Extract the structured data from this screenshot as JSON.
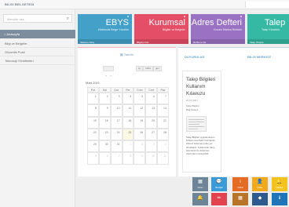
{
  "topbar": {
    "title": "BILGI BELGETESI"
  },
  "sidebar": {
    "search_placeholder": "Menüde ara...",
    "items": [
      {
        "label": "Anasayfa",
        "active": true
      },
      {
        "label": "Bilgi ve Belgeler"
      },
      {
        "label": "Güvenlik Posti"
      },
      {
        "label": "Teknoloji Yönetimleri"
      }
    ]
  },
  "tiles": [
    {
      "name": "EBYS",
      "sub": "Elektronik Belge Yönetim",
      "foot": "Sisteme Giriş",
      "color": "#43a0c8"
    },
    {
      "name": "Kurumsal",
      "sub": "Bilgiler ve Belgeler",
      "foot": "Bilgileri Gör",
      "color": "#e54e67"
    },
    {
      "name": "Adres Defteri",
      "sub": "Kurum Telefon Rehberi",
      "foot": "Rehbere Git",
      "color": "#9a72c4"
    },
    {
      "name": "Talep",
      "sub": "Talep Yönetimi",
      "foot": "Talep Oluştur",
      "color": "#35b8a4"
    }
  ],
  "calendar": {
    "title": "Takvim",
    "nav_prev": "‹",
    "nav_next": "›",
    "views": [
      "ay",
      "hafta",
      "gün"
    ],
    "month_label": "Mart 2021",
    "weekdays": [
      "Pzt",
      "Sal",
      "Çar",
      "Per",
      "Cum",
      "Cmt",
      "Paz"
    ],
    "weeks": [
      [
        "1",
        "2",
        "3",
        "4",
        "5",
        "6",
        "7"
      ],
      [
        "8",
        "9",
        "10",
        "11",
        "12",
        "13",
        "14"
      ],
      [
        "15",
        "16",
        "17",
        "18",
        "19",
        "20",
        "21"
      ],
      [
        "22",
        "23",
        "24",
        "25",
        "26",
        "27",
        "28"
      ],
      [
        "29",
        "30",
        "31",
        "1",
        "2",
        "3",
        "4"
      ],
      [
        "5",
        "6",
        "7",
        "8",
        "9",
        "10",
        "11"
      ]
    ],
    "today": "25"
  },
  "news": {
    "heading_left": "DUYURULAR",
    "heading_right": "BİLGİ MERKEZİ",
    "card_title": "Talep Bilgileri Kullanım Kılavuzu",
    "card_date": "26.03.2021",
    "card_lines": [
      "Talep Bilgileri",
      "Bilgi Sistemi"
    ],
    "card_body": "Talep Bilgileri uygulamasının kullanımına ilişkin hazırlanan kılavuz dokümanı ekte yer almaktadır. Kullanıcılar talep işlemlerini bu doküman üzerinden inceleyebilir."
  },
  "quick_buttons": [
    {
      "label": "Görev",
      "icon": "▦",
      "color": "#6d8596"
    },
    {
      "label": "Mesajlar",
      "icon": "💬",
      "color": "#3a9bd9"
    },
    {
      "label": "Yardım",
      "icon": "i",
      "color": "#e46c25"
    },
    {
      "label": "Kişiler",
      "icon": "👤",
      "color": "#f2aa1b"
    },
    {
      "label": "Uyarılar",
      "icon": "🔔",
      "color": "#f3c420"
    }
  ],
  "quick_buttons_2": [
    {
      "icon": "🔔",
      "color": "#6d8596"
    },
    {
      "icon": "✏",
      "color": "#e3434f"
    },
    {
      "icon": "▦",
      "color": "#b8752a"
    },
    {
      "icon": "◆",
      "color": "#2f5a8e"
    },
    {
      "icon": "ℹ",
      "color": "#1e75b8"
    }
  ]
}
